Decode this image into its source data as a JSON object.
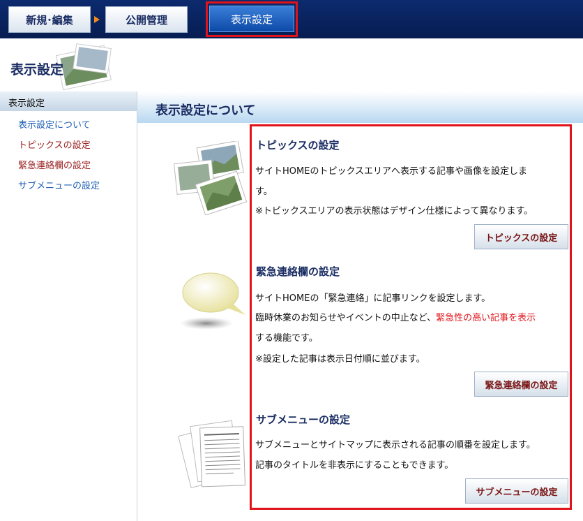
{
  "topnav": {
    "tabs": [
      {
        "label": "新規･編集"
      },
      {
        "label": "公開管理"
      },
      {
        "label": "表示設定"
      }
    ]
  },
  "header": {
    "title": "表示設定"
  },
  "sidebar": {
    "heading": "表示設定",
    "items": [
      {
        "label": "表示設定について"
      },
      {
        "label": "トピックスの設定"
      },
      {
        "label": "緊急連絡欄の設定"
      },
      {
        "label": "サブメニューの設定"
      }
    ]
  },
  "main": {
    "title": "表示設定について",
    "sections": [
      {
        "title": "トピックスの設定",
        "lines": [
          "サイトHOMEのトピックスエリアへ表示する記事や画像を設定しま",
          "す。",
          "※トピックスエリアの表示状態はデザイン仕様によって異なります。"
        ],
        "button": "トピックスの設定"
      },
      {
        "title": "緊急連絡欄の設定",
        "lines": [
          "サイトHOMEの「緊急連絡」に記事リンクを設定します。",
          "臨時休業のお知らせやイベントの中止など、",
          "緊急性の高い記事を表示",
          "する機能です。",
          "※設定した記事は表示日付順に並びます。"
        ],
        "button": "緊急連絡欄の設定"
      },
      {
        "title": "サブメニューの設定",
        "lines": [
          "サブメニューとサイトマップに表示される記事の順番を設定します。",
          "記事のタイトルを非表示にすることもできます。"
        ],
        "button": "サブメニューの設定"
      }
    ]
  },
  "colors": {
    "highlight_frame": "#e0131a",
    "nav_bg": "#0c2a6e",
    "active_tab": "#1d5fc0",
    "link_blue": "#1f5fb5",
    "link_red": "#9a2020"
  }
}
